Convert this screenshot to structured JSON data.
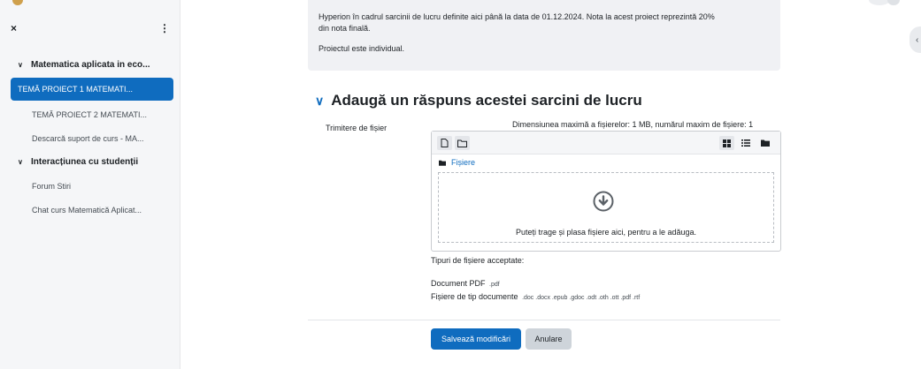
{
  "sidebar": {
    "close_icon": "×",
    "menu_icon": "⋮",
    "sections": [
      {
        "label": "Matematica aplicata in eco..."
      },
      {
        "label": "Interacțiunea cu studenții"
      }
    ],
    "items": [
      {
        "label": "TEMĂ PROIECT 1 MATEMATI...",
        "active": true
      },
      {
        "label": "TEMĂ PROIECT 2 MATEMATI..."
      },
      {
        "label": "Descarcă suport de curs - MA..."
      },
      {
        "label": "Forum Stiri"
      },
      {
        "label": "Chat curs Matematică Aplicat..."
      }
    ]
  },
  "assignment": {
    "description_line1": "Hyperion în cadrul sarcinii de lucru definite aici până la data de 01.12.2024. Nota la acest proiect reprezintă 20%",
    "description_line2": "din nota finală.",
    "note": "Proiectul este individual."
  },
  "submission": {
    "heading": "Adaugă un răspuns acestei sarcini de lucru",
    "field_label": "Trimitere de fișier",
    "max_size": "Dimensiunea maximă a fișierelor: 1 MB, numărul maxim de fișiere: 1",
    "path_label": "Fișiere",
    "dropzone_text": "Puteți trage și plasa fișiere aici, pentru a le adăuga.",
    "accepted_types_heading": "Tipuri de fișiere acceptate:",
    "accepted_types": [
      {
        "name": "Document PDF",
        "ext": ".pdf"
      },
      {
        "name": "Fișiere de tip documente",
        "ext": ".doc .docx .epub .gdoc .odt .oth .ott .pdf .rtf"
      }
    ]
  },
  "buttons": {
    "save": "Salvează modificări",
    "cancel": "Anulare"
  },
  "colors": {
    "primary": "#0f6cbf",
    "sidebar_bg": "#f5f6f8",
    "info_bg": "#f0f1f4"
  }
}
